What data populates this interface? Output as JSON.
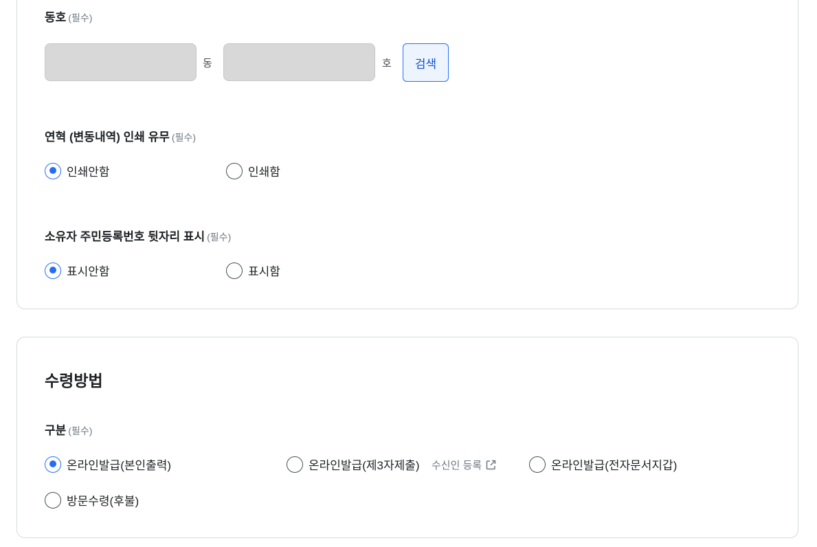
{
  "address_section": {
    "dongho": {
      "label": "동호",
      "required": "(필수)",
      "dong_value": "",
      "dong_unit": "동",
      "ho_value": "",
      "ho_unit": "호",
      "search_label": "검색"
    },
    "history_print": {
      "label": "연혁 (변동내역) 인쇄 유무",
      "required": "(필수)",
      "options": [
        "인쇄안함",
        "인쇄함"
      ],
      "selected": "인쇄안함"
    },
    "owner_id_display": {
      "label": "소유자 주민등록번호 뒷자리 표시",
      "required": "(필수)",
      "options": [
        "표시안함",
        "표시함"
      ],
      "selected": "표시안함"
    }
  },
  "receipt_section": {
    "title": "수령방법",
    "category": {
      "label": "구분",
      "required": "(필수)",
      "options": [
        "온라인발급(본인출력)",
        "온라인발급(제3자제출)",
        "온라인발급(전자문서지갑)",
        "방문수령(후불)"
      ],
      "selected": "온라인발급(본인출력)",
      "recipient_link": "수신인 등록",
      "recipient_link_icon": "external-link-icon"
    }
  },
  "colors": {
    "accent": "#256ef4",
    "border": "#d6d9de",
    "field_bg": "#d8d8d8",
    "muted_text": "#6d7882"
  }
}
